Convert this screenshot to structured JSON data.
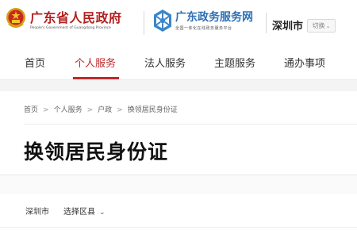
{
  "header": {
    "gov_title": "广东省人民政府",
    "gov_subtitle": "People's Government of Guangdong Province",
    "service_title": "广东政务服务网",
    "service_subtitle": "全国一体化在线政务服务平台",
    "city": "深圳市",
    "switch_label": "切换",
    "emblem_icon": "national-emblem-icon",
    "logo_icon": "service-network-logo-icon"
  },
  "nav": {
    "items": [
      {
        "label": "首页"
      },
      {
        "label": "个人服务",
        "active": true
      },
      {
        "label": "法人服务"
      },
      {
        "label": "主题服务"
      },
      {
        "label": "通办事项"
      }
    ]
  },
  "breadcrumb": {
    "items": [
      "首页",
      "个人服务",
      "户政",
      "换领居民身份证"
    ],
    "separator": ">"
  },
  "page": {
    "title": "换领居民身份证"
  },
  "region": {
    "city": "深圳市",
    "select_label": "选择区县"
  },
  "colors": {
    "accent_red": "#c0282d",
    "gov_red": "#b3201f",
    "service_blue": "#2f6fb5"
  }
}
